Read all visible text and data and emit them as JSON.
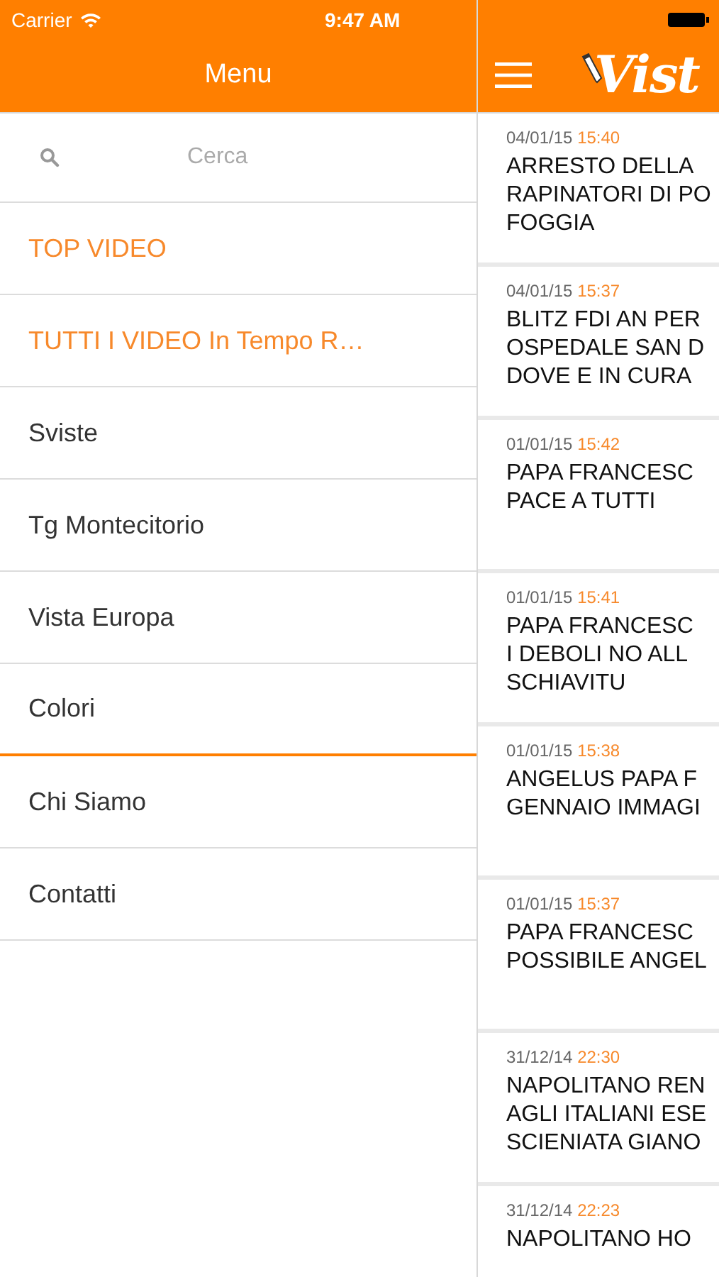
{
  "status_bar": {
    "carrier": "Carrier",
    "time": "9:47 AM"
  },
  "menu": {
    "title": "Menu",
    "search": {
      "placeholder": "Cerca"
    },
    "items": [
      {
        "label": "TOP VIDEO",
        "kind": "featured",
        "selected": false
      },
      {
        "label": "TUTTI I VIDEO In Tempo R…",
        "kind": "featured",
        "selected": false
      },
      {
        "label": "Sviste",
        "kind": "normal",
        "selected": false
      },
      {
        "label": "Tg Montecitorio",
        "kind": "normal",
        "selected": false
      },
      {
        "label": "Vista Europa",
        "kind": "normal",
        "selected": false
      },
      {
        "label": "Colori",
        "kind": "normal",
        "selected": true
      },
      {
        "label": "Chi Siamo",
        "kind": "normal",
        "selected": false
      },
      {
        "label": "Contatti",
        "kind": "normal",
        "selected": false
      }
    ]
  },
  "feed": {
    "logo_text": "Vist",
    "articles": [
      {
        "date": "04/01/15",
        "time": "15:40",
        "lines": [
          "ARRESTO DELLA",
          "RAPINATORI DI PO",
          "FOGGIA"
        ]
      },
      {
        "date": "04/01/15",
        "time": "15:37",
        "lines": [
          "BLITZ FDI AN PER",
          "OSPEDALE SAN D",
          "DOVE E IN CURA"
        ]
      },
      {
        "date": "01/01/15",
        "time": "15:42",
        "lines": [
          "PAPA FRANCESC",
          "PACE A TUTTI"
        ]
      },
      {
        "date": "01/01/15",
        "time": "15:41",
        "lines": [
          "PAPA FRANCESC",
          "I DEBOLI NO ALL",
          "SCHIAVITU"
        ]
      },
      {
        "date": "01/01/15",
        "time": "15:38",
        "lines": [
          "ANGELUS PAPA F",
          "GENNAIO IMMAGI"
        ]
      },
      {
        "date": "01/01/15",
        "time": "15:37",
        "lines": [
          "PAPA FRANCESC",
          "POSSIBILE ANGEL"
        ]
      },
      {
        "date": "31/12/14",
        "time": "22:30",
        "lines": [
          "NAPOLITANO REN",
          "AGLI ITALIANI ESE",
          "SCIENIATA GIANO"
        ]
      },
      {
        "date": "31/12/14",
        "time": "22:23",
        "lines": [
          "NAPOLITANO HO"
        ]
      }
    ]
  }
}
